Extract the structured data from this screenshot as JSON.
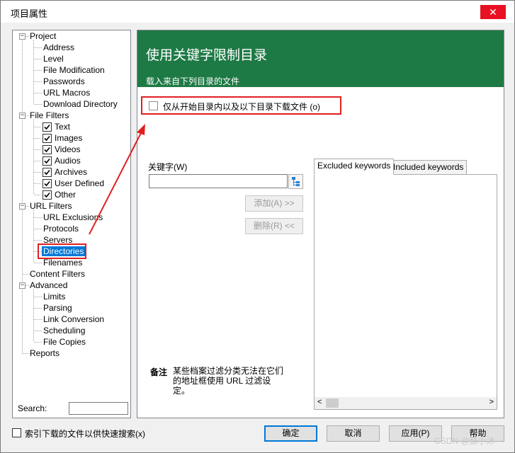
{
  "window": {
    "title": "项目属性",
    "close_glyph": "✕"
  },
  "tree": {
    "project": "Project",
    "project_children": [
      "Address",
      "Level",
      "File Modification",
      "Passwords",
      "URL Macros",
      "Download Directory"
    ],
    "file_filters": "File Filters",
    "file_filter_children": [
      {
        "label": "Text",
        "checked": true
      },
      {
        "label": "Images",
        "checked": true
      },
      {
        "label": "Videos",
        "checked": true
      },
      {
        "label": "Audios",
        "checked": true
      },
      {
        "label": "Archives",
        "checked": true
      },
      {
        "label": "User Defined",
        "checked": true
      },
      {
        "label": "Other",
        "checked": true
      }
    ],
    "url_filters": "URL Filters",
    "url_filter_children": [
      "URL Exclusions",
      "Protocols",
      "Servers",
      "Directories",
      "Filenames"
    ],
    "selected": "Directories",
    "content_filters": "Content Filters",
    "advanced": "Advanced",
    "advanced_children": [
      "Limits",
      "Parsing",
      "Link Conversion",
      "Scheduling",
      "File Copies"
    ],
    "reports": "Reports",
    "expander_minus": "−",
    "search_label": "Search:"
  },
  "panel": {
    "header_title": "使用关键字限制目录",
    "header_subtitle": "载入来自下列目录的文件",
    "option_label": "仅从开始目录内以及以下目录下载文件 (o)",
    "keyword_label": "关键字(W)",
    "keyword_value": "",
    "add_button": "添加(A) >>",
    "delete_button": "删除(R) <<",
    "tabs": [
      "Excluded keywords",
      "Included keywords"
    ],
    "scroll_left": "<",
    "scroll_right": ">",
    "note_title": "备注",
    "note_text": "某些档案过滤分类无法在它们的地址框使用 URL 过滤设定。"
  },
  "footer": {
    "index_label": "索引下载的文件以供快速搜索(x)",
    "ok": "确定",
    "cancel": "取消",
    "apply": "应用(P)",
    "help": "帮助",
    "watermark": "CSDN @蘇小沐"
  },
  "colors": {
    "header_green": "#1e7a45",
    "selection_blue": "#0078d7",
    "annotation_red": "#e02020",
    "close_red": "#e81123"
  }
}
